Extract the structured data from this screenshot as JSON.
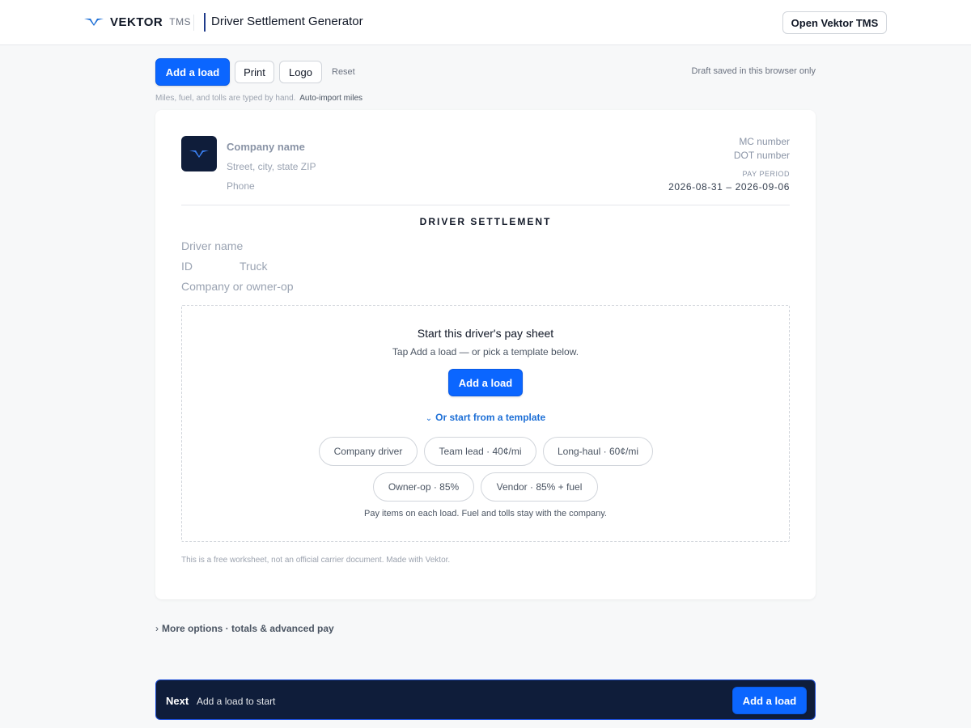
{
  "header": {
    "brand_name": "VEKTOR",
    "brand_suffix": "TMS",
    "page_title": "Driver Settlement Generator",
    "open_tms_label": "Open Vektor TMS"
  },
  "toolbar": {
    "add_load_label": "Add a load",
    "print_label": "Print",
    "logo_label": "Logo",
    "reset_label": "Reset",
    "draft_note": "Draft saved in this browser only",
    "hand_note": "Miles, fuel, and tolls are typed by hand.",
    "auto_import_label": "Auto-import miles"
  },
  "settlement": {
    "company_name": "Company name",
    "company_address": "Street, city, state ZIP",
    "company_phone": "Phone",
    "mc_number": "MC number",
    "dot_number": "DOT number",
    "pay_period_label": "PAY PERIOD",
    "pay_period_start": "2026-08-31",
    "pay_period_end": "2026-09-06",
    "pay_period_text": "2026-08-31 –  2026-09-06",
    "doc_title": "DRIVER SETTLEMENT",
    "driver_name": "Driver name",
    "driver_id": "ID",
    "truck": "Truck",
    "company_or_owner": "Company or owner-op",
    "footer_note": "This is a free worksheet, not an official carrier document. Made with Vektor."
  },
  "empty_state": {
    "title": "Start this driver's pay sheet",
    "subtitle": "Tap Add a load — or pick a template below.",
    "add_load_label": "Add a load",
    "template_toggle": "Or start from a template",
    "templates": [
      "Company driver",
      "Team lead · 40¢/mi",
      "Long-haul · 60¢/mi",
      "Owner-op · 85%",
      "Vendor · 85% + fuel"
    ],
    "note": "Pay items on each load. Fuel and tolls stay with the company."
  },
  "more_options_label": "More options · totals & advanced pay",
  "next_bar": {
    "label": "Next",
    "text": "Add a load to start",
    "add_load_label": "Add a load"
  },
  "icons": {
    "brand": "vektor-wing-icon",
    "chevron_down": "chevron-down-icon",
    "chevron_right": "chevron-right-icon"
  },
  "colors": {
    "primary": "#0b66ff",
    "navy": "#0f1d3a",
    "link": "#1d6fd6"
  }
}
